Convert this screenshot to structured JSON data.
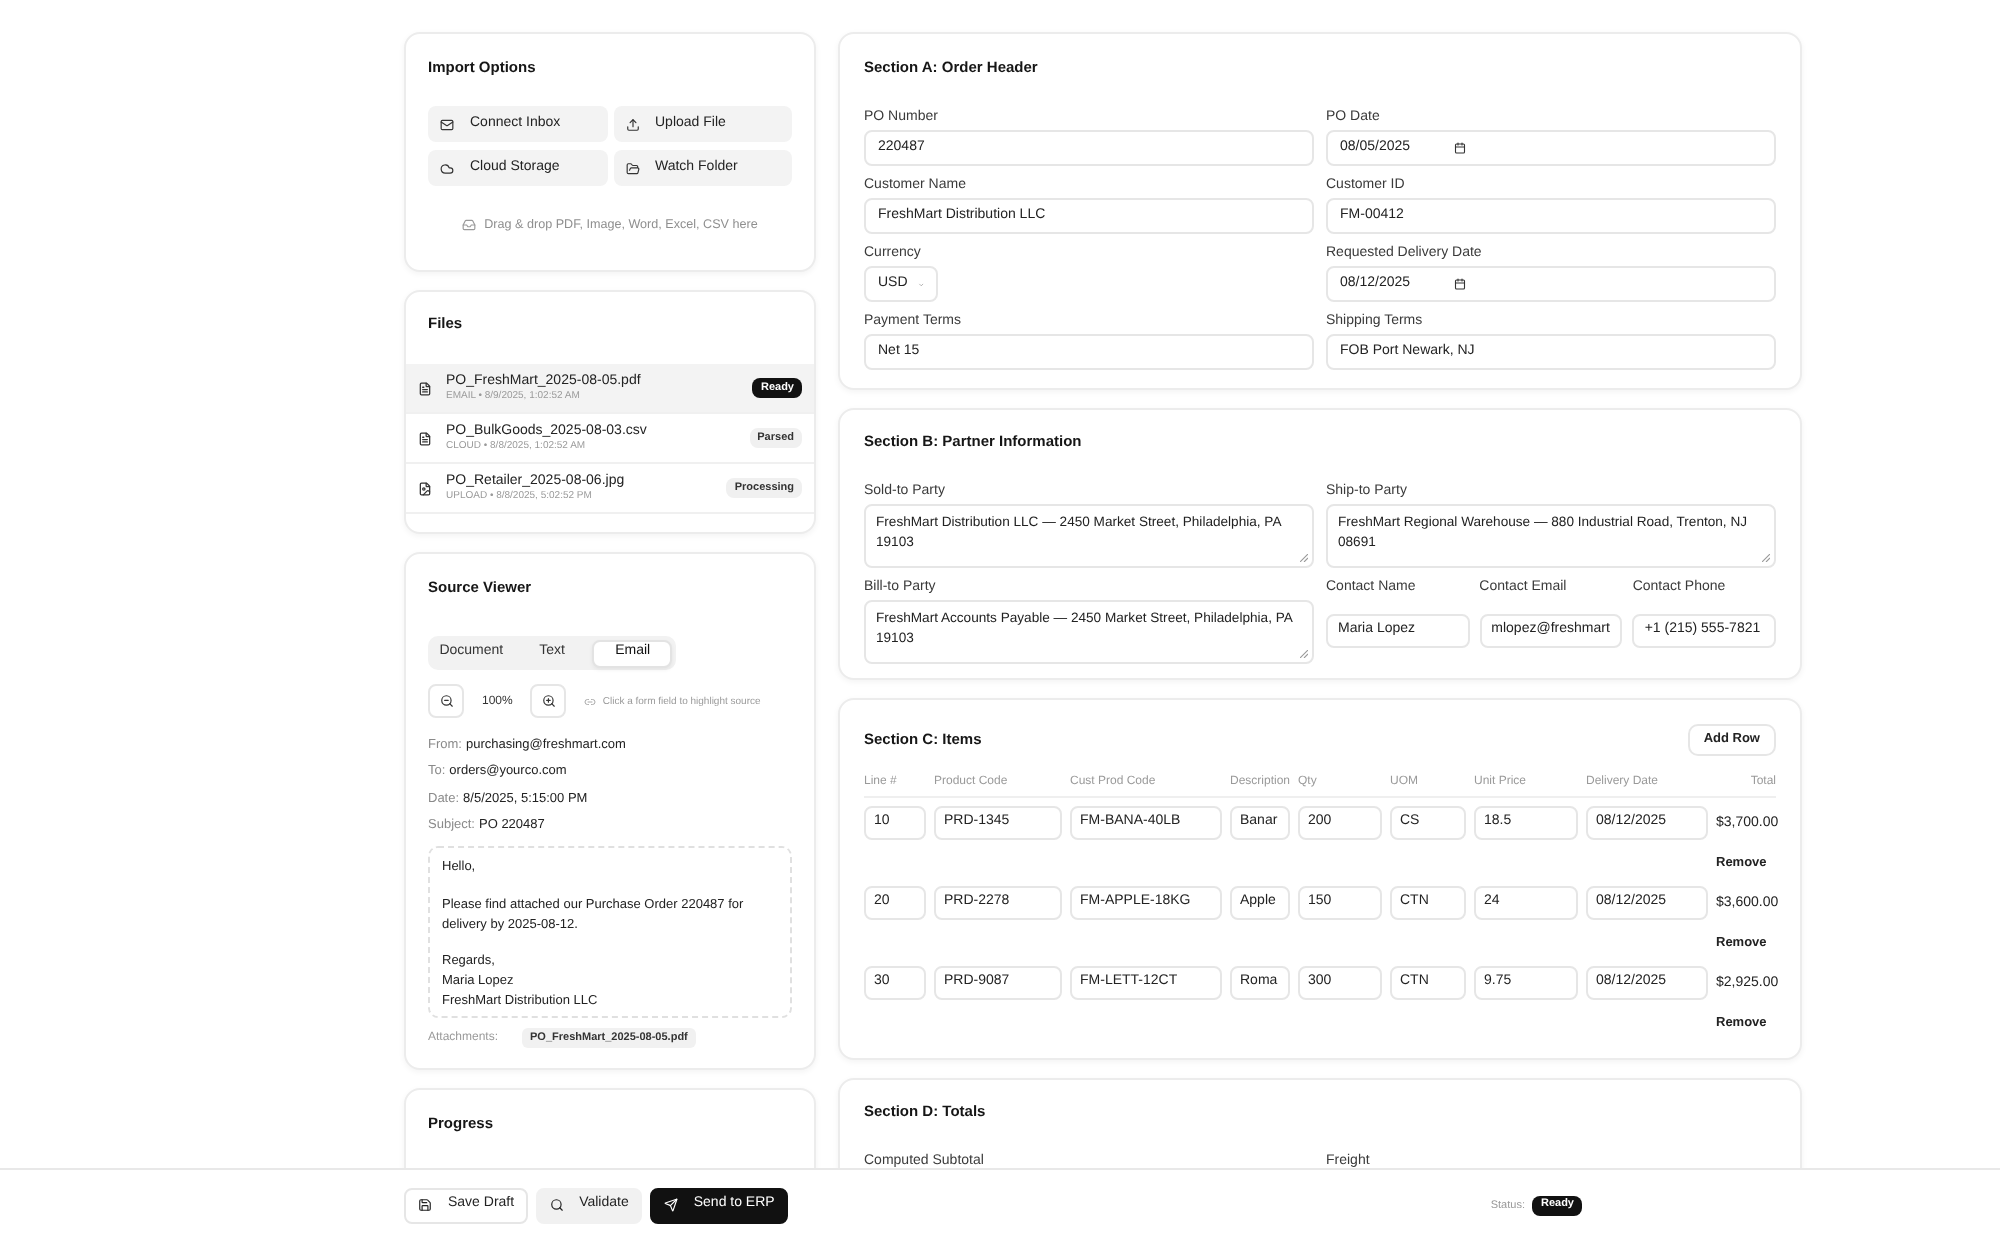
{
  "import_options": {
    "title": "Import Options",
    "buttons": [
      "Connect Inbox",
      "Upload File",
      "Cloud Storage",
      "Watch Folder"
    ],
    "drop_hint": "Drag & drop PDF, Image, Word, Excel, CSV here"
  },
  "files": {
    "title": "Files",
    "items": [
      {
        "name": "PO_FreshMart_2025-08-05.pdf",
        "meta": "EMAIL • 8/9/2025, 1:02:52 AM",
        "kind": "document",
        "selected": true,
        "status": {
          "label": "Ready",
          "kind": "solid"
        }
      },
      {
        "name": "PO_BulkGoods_2025-08-03.csv",
        "meta": "CLOUD • 8/8/2025, 1:02:52 AM",
        "kind": "document",
        "selected": false,
        "status": {
          "label": "Parsed",
          "kind": "soft"
        }
      },
      {
        "name": "PO_Retailer_2025-08-06.jpg",
        "meta": "UPLOAD • 8/8/2025, 5:02:52 PM",
        "kind": "image",
        "selected": false,
        "status": {
          "label": "Processing",
          "kind": "soft"
        }
      }
    ]
  },
  "source_viewer": {
    "title": "Source Viewer",
    "tabs": [
      {
        "label": "Document",
        "selected": false
      },
      {
        "label": "Text",
        "selected": false
      },
      {
        "label": "Email",
        "selected": true
      }
    ],
    "zoom_level": "100%",
    "hint": "Click a form field to highlight source",
    "email": {
      "headers": [
        {
          "label": "From:",
          "value": "purchasing@freshmart.com"
        },
        {
          "label": "To:",
          "value": "orders@yourco.com"
        },
        {
          "label": "Date:",
          "value": "8/5/2025, 5:15:00 PM"
        },
        {
          "label": "Subject:",
          "value": "PO 220487"
        }
      ],
      "body": [
        [
          "Hello,"
        ],
        [
          "Please find attached our Purchase Order 220487 for delivery by 2025-08-12."
        ],
        [
          "Regards,",
          "Maria Lopez",
          "FreshMart Distribution LLC"
        ]
      ],
      "attachments_label": "Attachments:",
      "attachments": [
        "PO_FreshMart_2025-08-05.pdf"
      ]
    }
  },
  "progress": {
    "title": "Progress"
  },
  "section_a": {
    "title": "Section A: Order Header",
    "fields": [
      {
        "label": "PO Number",
        "value": "220487",
        "kind": "text"
      },
      {
        "label": "PO Date",
        "value": "08/05/2025",
        "kind": "date"
      },
      {
        "label": "Customer Name",
        "value": "FreshMart Distribution LLC",
        "kind": "text"
      },
      {
        "label": "Customer ID",
        "value": "FM-00412",
        "kind": "text"
      },
      {
        "label": "Currency",
        "value": "USD",
        "kind": "select"
      },
      {
        "label": "Requested Delivery Date",
        "value": "08/12/2025",
        "kind": "date"
      },
      {
        "label": "Payment Terms",
        "value": "Net 15",
        "kind": "text"
      },
      {
        "label": "Shipping Terms",
        "value": "FOB Port Newark, NJ",
        "kind": "text"
      }
    ]
  },
  "section_b": {
    "title": "Section B: Partner Information",
    "parties": [
      {
        "label": "Sold-to Party",
        "value": "FreshMart Distribution LLC — 2450 Market Street, Philadelphia, PA 19103"
      },
      {
        "label": "Ship-to Party",
        "value": "FreshMart Regional Warehouse — 880 Industrial Road, Trenton, NJ 08691"
      },
      {
        "label": "Bill-to Party",
        "value": "FreshMart Accounts Payable — 2450 Market Street, Philadelphia, PA 19103"
      }
    ],
    "contacts": [
      {
        "label": "Contact Name",
        "value": "Maria Lopez"
      },
      {
        "label": "Contact Email",
        "value": "mlopez@freshmart"
      },
      {
        "label": "Contact Phone",
        "value": "+1 (215) 555-7821"
      }
    ]
  },
  "section_c": {
    "title": "Section C: Items",
    "add_button": "Add Row",
    "columns": [
      "Line #",
      "Product Code",
      "Cust Prod Code",
      "Description",
      "Qty",
      "UOM",
      "Unit Price",
      "Delivery Date",
      "Total"
    ],
    "rows": [
      {
        "cells": [
          "10",
          "PRD-1345",
          "FM-BANA-40LB",
          "Banar",
          "200",
          "CS",
          "18.5",
          "08/12/2025"
        ],
        "total": "$3,700.00",
        "remove": "Remove"
      },
      {
        "cells": [
          "20",
          "PRD-2278",
          "FM-APPLE-18KG",
          "Apple",
          "150",
          "CTN",
          "24",
          "08/12/2025"
        ],
        "total": "$3,600.00",
        "remove": "Remove"
      },
      {
        "cells": [
          "30",
          "PRD-9087",
          "FM-LETT-12CT",
          "Roma",
          "300",
          "CTN",
          "9.75",
          "08/12/2025"
        ],
        "total": "$2,925.00",
        "remove": "Remove"
      }
    ]
  },
  "section_d": {
    "title": "Section D: Totals",
    "fields": [
      "Computed Subtotal",
      "Freight"
    ]
  },
  "footer": {
    "buttons": [
      {
        "label": "Save Draft",
        "kind": "outline"
      },
      {
        "label": "Validate",
        "kind": "soft"
      },
      {
        "label": "Send to ERP",
        "kind": "primary"
      }
    ],
    "status_label": "Status:",
    "status": "Ready"
  }
}
